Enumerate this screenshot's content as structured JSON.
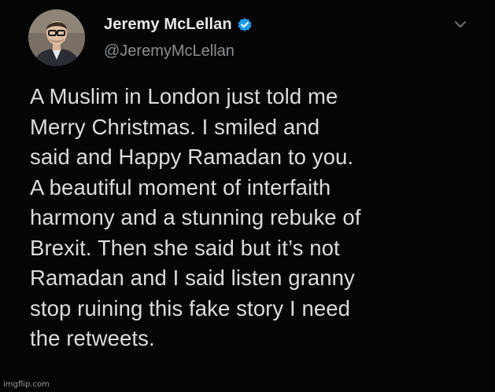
{
  "tweet": {
    "author": {
      "display_name": "Jeremy McLellan",
      "handle": "@JeremyMcLellan",
      "verified": true,
      "avatar_icon": "avatar-photo"
    },
    "menu_icon": "chevron-down-icon",
    "text": "A Muslim in London just told me\nMerry Christmas. I smiled and\nsaid and Happy Ramadan to you.\nA beautiful moment of interfaith\nharmony and a stunning rebuke of\nBrexit. Then she said but it’s not\nRamadan and I said listen granny\nstop ruining this fake story I need\nthe retweets."
  },
  "watermark": "imgflip.com",
  "colors": {
    "background": "#050505",
    "text": "#dcdcdc",
    "handle": "#8a8d91",
    "verified_badge": "#1d9bf0"
  }
}
